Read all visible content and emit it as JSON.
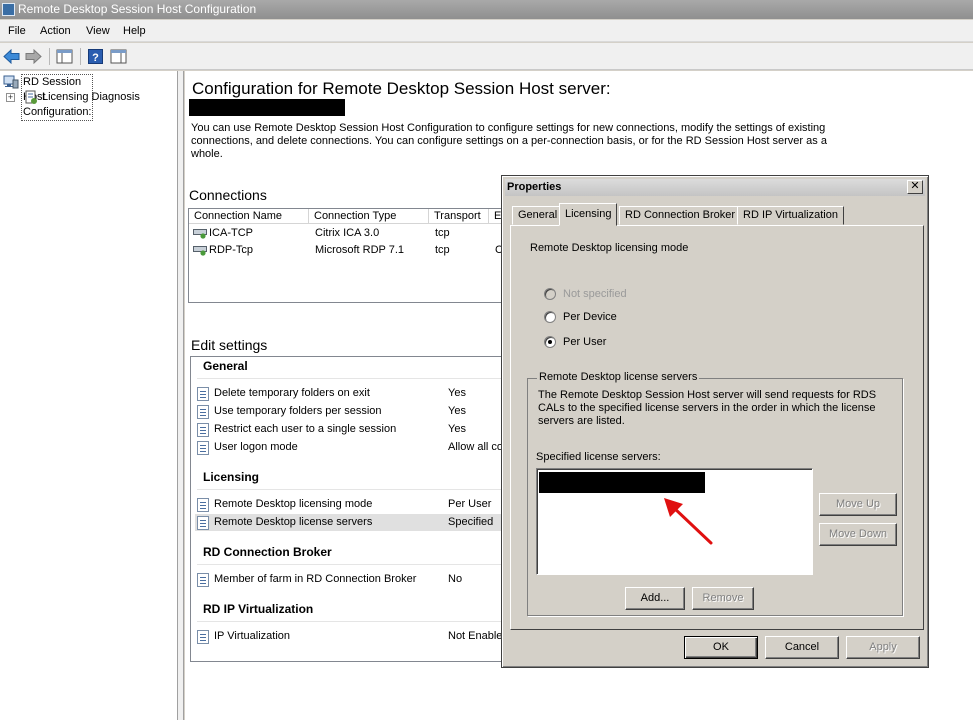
{
  "window": {
    "title": "Remote Desktop Session Host Configuration"
  },
  "menu": {
    "file": "File",
    "action": "Action",
    "view": "View",
    "help": "Help"
  },
  "tree": {
    "root": "RD Session Host Configuration:",
    "child": "Licensing Diagnosis"
  },
  "main": {
    "title": "Configuration for Remote Desktop Session Host server:",
    "description": "You can use Remote Desktop Session Host Configuration to configure settings for new connections, modify the settings of existing connections, and delete connections. You can configure settings on a per-connection basis, or for the RD Session Host server as a whole.",
    "connections_heading": "Connections",
    "columns": [
      "Connection Name",
      "Connection Type",
      "Transport",
      "E"
    ],
    "connections": [
      {
        "name": "ICA-TCP",
        "type": "Citrix ICA 3.0",
        "transport": "tcp",
        "extra": ""
      },
      {
        "name": "RDP-Tcp",
        "type": "Microsoft RDP 7.1",
        "transport": "tcp",
        "extra": "C"
      }
    ],
    "edit_heading": "Edit settings",
    "groups": {
      "general": {
        "heading": "General",
        "rows": [
          {
            "name": "Delete temporary folders on exit",
            "value": "Yes"
          },
          {
            "name": "Use temporary folders per session",
            "value": "Yes"
          },
          {
            "name": "Restrict each user to a single session",
            "value": "Yes"
          },
          {
            "name": "User logon mode",
            "value": "Allow all co"
          }
        ]
      },
      "licensing": {
        "heading": "Licensing",
        "rows": [
          {
            "name": "Remote Desktop licensing mode",
            "value": "Per User"
          },
          {
            "name": "Remote Desktop license servers",
            "value": "Specified"
          }
        ]
      },
      "broker": {
        "heading": "RD Connection Broker",
        "rows": [
          {
            "name": "Member of farm in RD Connection Broker",
            "value": "No"
          }
        ]
      },
      "ipv": {
        "heading": "RD IP Virtualization",
        "rows": [
          {
            "name": "IP Virtualization",
            "value": "Not Enable"
          }
        ]
      }
    }
  },
  "dialog": {
    "title": "Properties",
    "close": "✕",
    "tabs": [
      "General",
      "Licensing",
      "RD Connection Broker",
      "RD IP Virtualization"
    ],
    "active_tab": "Licensing",
    "mode_label": "Remote Desktop licensing mode",
    "options": {
      "not_specified": "Not specified",
      "per_device": "Per Device",
      "per_user": "Per User"
    },
    "selected_option": "Per User",
    "servers_group": "Remote Desktop license servers",
    "servers_desc": "The Remote Desktop Session Host server will send requests for RDS CALs to the specified license servers in the order in which the license servers are listed.",
    "servers_list_label": "Specified license servers:",
    "buttons": {
      "move_up": "Move Up",
      "move_down": "Move Down",
      "add": "Add...",
      "remove": "Remove",
      "ok": "OK",
      "cancel": "Cancel",
      "apply": "Apply"
    }
  },
  "colors": {
    "annotation_arrow": "#e01010",
    "redaction": "#000000"
  }
}
